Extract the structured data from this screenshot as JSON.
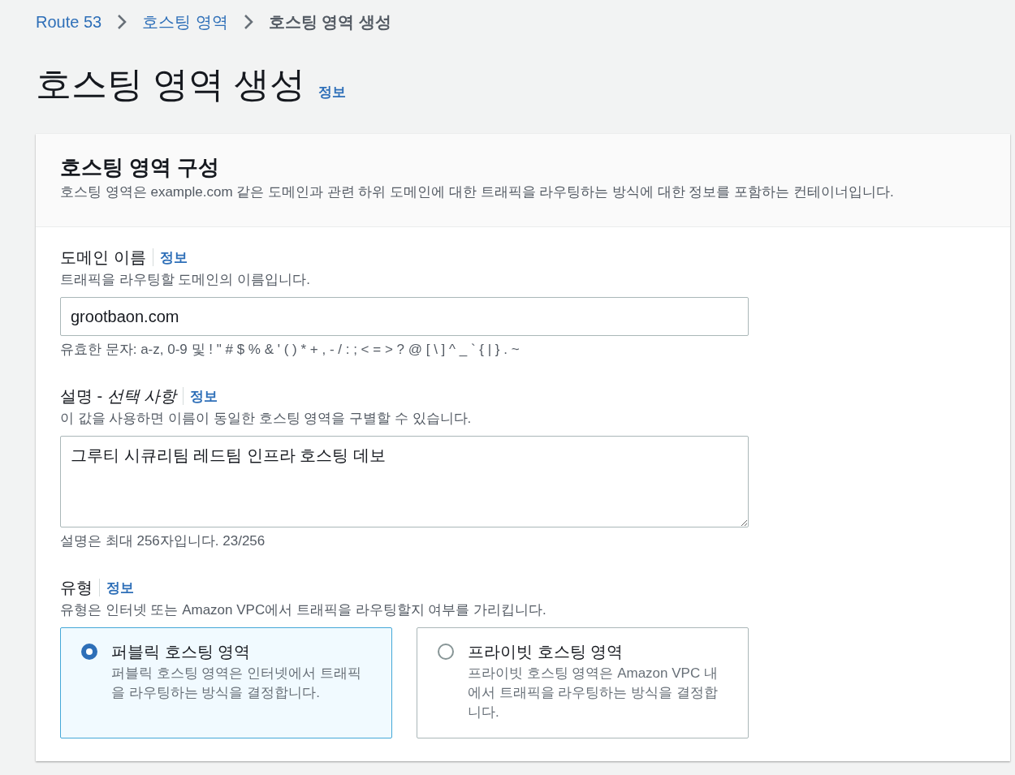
{
  "breadcrumb": [
    {
      "label": "Route 53",
      "link": true
    },
    {
      "label": "호스팅 영역",
      "link": true
    },
    {
      "label": "호스팅 영역 생성",
      "link": false
    }
  ],
  "page_title": "호스팅 영역 생성",
  "page_info": "정보",
  "panel": {
    "title": "호스팅 영역 구성",
    "description": "호스팅 영역은 example.com 같은 도메인과 관련 하위 도메인에 대한 트래픽을 라우팅하는 방식에 대한 정보를 포함하는 컨테이너입니다.",
    "fields": [
      {
        "kind": "input",
        "label": "도메인 이름",
        "info": "정보",
        "hint": "트래픽을 라우팅할 도메인의 이름입니다.",
        "value": "grootbaon.com",
        "constraint": "유효한 문자: a-z, 0-9 및 ! \" # $ % & ' ( ) * + , - / : ; < = > ? @ [ \\ ] ^ _ ` { | } . ~"
      },
      {
        "kind": "textarea",
        "label": "설명 - *선택 사항*",
        "info": "정보",
        "hint": "이 값을 사용하면 이름이 동일한 호스팅 영역을 구별할 수 있습니다.",
        "value": "그루티 시큐리팀 레드팀 인프라 호스팅 데보",
        "constraint": "설명은 최대 256자입니다. 23/256"
      },
      {
        "kind": "tiles",
        "label": "유형",
        "info": "정보",
        "hint": "유형은 인터넷 또는 Amazon VPC에서 트래픽을 라우팅할지 여부를 가리킵니다.",
        "options": [
          {
            "label": "퍼블릭 호스팅 영역",
            "description": "퍼블릭 호스팅 영역은 인터넷에서 트래픽을 라우팅하는 방식을 결정합니다.",
            "selected": true
          },
          {
            "label": "프라이빗 호스팅 영역",
            "description": "프라이빗 호스팅 영역은 Amazon VPC 내에서 트래픽을 라우팅하는 방식을 결정합니다.",
            "selected": false
          }
        ]
      }
    ]
  }
}
